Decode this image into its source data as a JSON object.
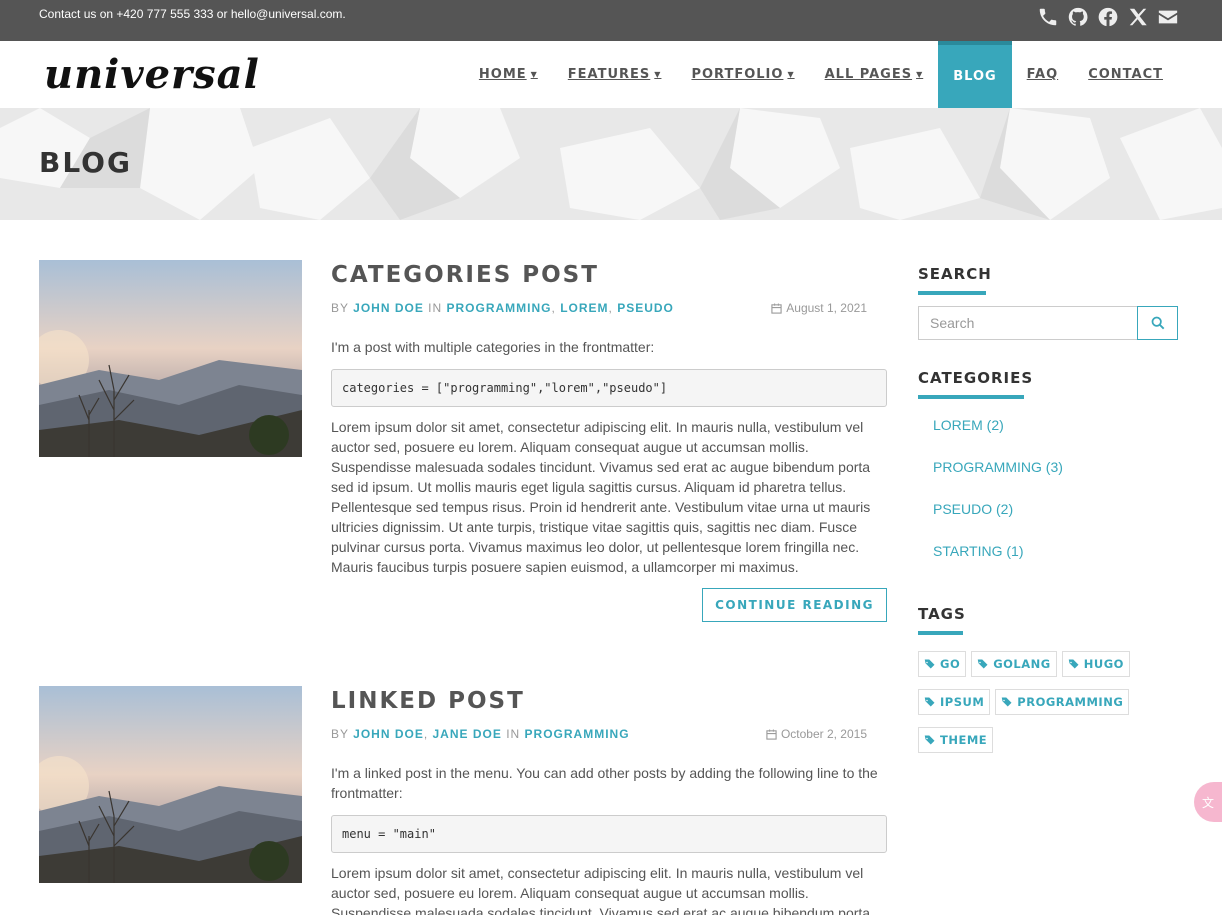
{
  "topbar": {
    "contact": "Contact us on +420 777 555 333 or hello@universal.com.",
    "social_icons": [
      "phone-icon",
      "github-icon",
      "facebook-icon",
      "x-icon",
      "envelope-icon"
    ]
  },
  "brand": {
    "logo": "universal"
  },
  "nav": {
    "items": [
      {
        "label": "HOME",
        "caret": true
      },
      {
        "label": "FEATURES",
        "caret": true
      },
      {
        "label": "PORTFOLIO",
        "caret": true
      },
      {
        "label": "ALL PAGES",
        "caret": true
      },
      {
        "label": "BLOG",
        "active": true
      },
      {
        "label": "FAQ"
      },
      {
        "label": "CONTACT"
      }
    ]
  },
  "page_title": "BLOG",
  "posts": [
    {
      "title": "CATEGORIES POST",
      "by": "BY",
      "authors": [
        "JOHN DOE"
      ],
      "in": "IN",
      "categories": [
        "PROGRAMMING",
        "LOREM",
        "PSEUDO"
      ],
      "date": "August 1, 2021",
      "intro": "I'm a post with multiple categories in the frontmatter:",
      "code": "categories = [\"programming\",\"lorem\",\"pseudo\"]",
      "excerpt": "Lorem ipsum dolor sit amet, consectetur adipiscing elit. In mauris nulla, vestibulum vel auctor sed, posuere eu lorem. Aliquam consequat augue ut accumsan mollis. Suspendisse malesuada sodales tincidunt. Vivamus sed erat ac augue bibendum porta sed id ipsum. Ut mollis mauris eget ligula sagittis cursus. Aliquam id pharetra tellus. Pellentesque sed tempus risus. Proin id hendrerit ante. Vestibulum vitae urna ut mauris ultricies dignissim. Ut ante turpis, tristique vitae sagittis quis, sagittis nec diam. Fusce pulvinar cursus porta. Vivamus maximus leo dolor, ut pellentesque lorem fringilla nec. Mauris faucibus turpis posuere sapien euismod, a ullamcorper mi maximus.",
      "button": "CONTINUE READING"
    },
    {
      "title": "LINKED POST",
      "by": "BY",
      "authors": [
        "JOHN DOE",
        "JANE DOE"
      ],
      "in": "IN",
      "categories": [
        "PROGRAMMING"
      ],
      "date": "October 2, 2015",
      "intro": "I'm a linked post in the menu. You can add other posts by adding the following line to the frontmatter:",
      "code": "menu = \"main\"",
      "excerpt": "Lorem ipsum dolor sit amet, consectetur adipiscing elit. In mauris nulla, vestibulum vel auctor sed, posuere eu lorem. Aliquam consequat augue ut accumsan mollis. Suspendisse malesuada sodales tincidunt. Vivamus sed erat ac augue bibendum porta"
    }
  ],
  "sidebar": {
    "search": {
      "title": "SEARCH",
      "placeholder": "Search"
    },
    "categories": {
      "title": "CATEGORIES",
      "items": [
        "LOREM (2)",
        "PROGRAMMING (3)",
        "PSEUDO (2)",
        "STARTING (1)"
      ]
    },
    "tags": {
      "title": "TAGS",
      "items": [
        "GO",
        "GOLANG",
        "HUGO",
        "IPSUM",
        "PROGRAMMING",
        "THEME"
      ]
    }
  },
  "colors": {
    "accent": "#38a7bb",
    "topbar": "#555555",
    "heading_band": "#e8e8e8"
  }
}
